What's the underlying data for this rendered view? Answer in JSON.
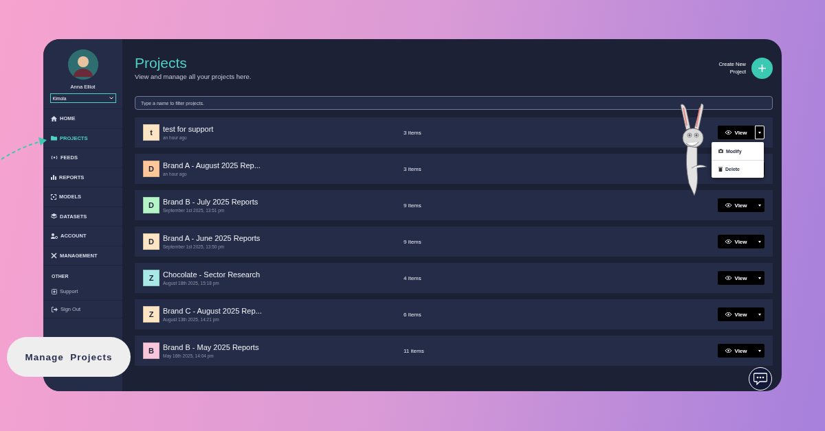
{
  "sidebar": {
    "user_name": "Anna Elliot",
    "workspace": "Kimola",
    "nav": [
      {
        "label": "HOME",
        "selected": false
      },
      {
        "label": "PROJECTS",
        "selected": true
      },
      {
        "label": "FEEDS",
        "selected": false
      },
      {
        "label": "REPORTS",
        "selected": false
      },
      {
        "label": "MODELS",
        "selected": false
      },
      {
        "label": "DATASETS",
        "selected": false
      },
      {
        "label": "ACCOUNT",
        "selected": false
      },
      {
        "label": "MANAGEMENT",
        "selected": false
      }
    ],
    "other_heading": "OTHER",
    "other_items": [
      {
        "label": "Support"
      },
      {
        "label": "Sign Out"
      }
    ]
  },
  "header": {
    "title": "Projects",
    "subtitle": "View and manage all your projects here.",
    "create_button": "Create New Project"
  },
  "filter": {
    "placeholder": "Type a name to filter projects."
  },
  "projects": [
    {
      "initial": "t",
      "color": "#fde5c4",
      "name": "test for support",
      "date": "an hour ago",
      "count": "3 items",
      "view": "View",
      "expanded": true,
      "menu": [
        "Modify",
        "Delete"
      ]
    },
    {
      "initial": "D",
      "color": "#fdc79a",
      "name": "Brand A - August 2025 Rep...",
      "date": "an hour ago",
      "count": "3 items",
      "expanded": false
    },
    {
      "initial": "D",
      "color": "#b5f5c8",
      "name": "Brand B - July 2025 Reports",
      "date": "September 1st 2025, 13:51 pm",
      "count": "9 items",
      "view": "View",
      "expanded": false
    },
    {
      "initial": "D",
      "color": "#fde5c4",
      "name": "Brand A - June 2025 Reports",
      "date": "September 1st 2025, 13:50 pm",
      "count": "9 items",
      "view": "View",
      "expanded": false
    },
    {
      "initial": "Z",
      "color": "#a8e8e6",
      "name": "Chocolate - Sector Research",
      "date": "August 18th 2025, 15:18 pm",
      "count": "4 items",
      "view": "View",
      "expanded": false
    },
    {
      "initial": "Z",
      "color": "#fde5c4",
      "name": "Brand C - August 2025 Rep...",
      "date": "August 13th 2025, 14:21 pm",
      "count": "6 items",
      "view": "View",
      "expanded": false
    },
    {
      "initial": "B",
      "color": "#f9c6dc",
      "name": "Brand B - May 2025 Reports",
      "date": "May 16th 2025, 14:04 pm",
      "count": "11 items",
      "view": "View",
      "expanded": false
    }
  ],
  "callout": "Manage  Projects"
}
